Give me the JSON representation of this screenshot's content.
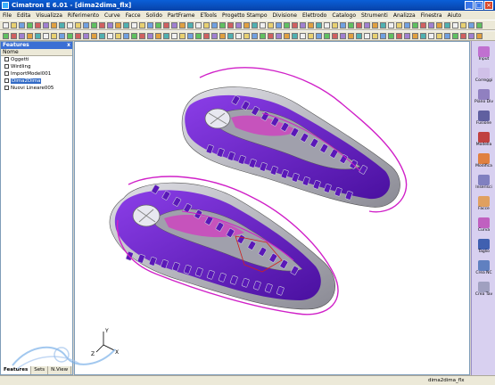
{
  "window": {
    "title": "Cimatron E 6.01 - [dima2dima_flx]",
    "minimize": "_",
    "maximize": "□",
    "close": "×"
  },
  "menu": [
    "File",
    "Edita",
    "Visualizza",
    "Riferimento",
    "Curve",
    "Facce",
    "Solido",
    "PartFrame",
    "ETools",
    "Progetto Stampo",
    "Divisione",
    "Elettrodo",
    "Catalogo",
    "Strumenti",
    "Analizza",
    "Finestra",
    "Aiuto"
  ],
  "features_panel": {
    "title": "Features",
    "close_label": "x",
    "column_header": "Nome",
    "items": [
      {
        "label": "Oggetti",
        "selected": false
      },
      {
        "label": "Wirdling",
        "selected": false
      },
      {
        "label": "ImportModel001",
        "selected": false
      },
      {
        "label": "Dima2Dima",
        "selected": true
      },
      {
        "label": "Nuovi Lineare005",
        "selected": false
      }
    ],
    "tabs": [
      {
        "label": "Features",
        "active": true
      },
      {
        "label": "Sets",
        "active": false
      },
      {
        "label": "N.View",
        "active": false
      }
    ]
  },
  "right_tools": [
    {
      "label": "Input",
      "icon": "input-icon",
      "color": "#c070d0"
    },
    {
      "label": "Correggi",
      "icon": "correggi-icon",
      "color": "#d0c0e8"
    },
    {
      "label": "Piano Div",
      "icon": "piano-div-icon",
      "color": "#9080c0"
    },
    {
      "label": "Fusione",
      "icon": "fusione-icon",
      "color": "#6060a0"
    },
    {
      "label": "Modella",
      "icon": "modella-icon",
      "color": "#c04040"
    },
    {
      "label": "Modifica",
      "icon": "modifica-icon",
      "color": "#e08040"
    },
    {
      "label": "Inserisci",
      "icon": "inserisci-icon",
      "color": "#8080c0"
    },
    {
      "label": "Facce",
      "icon": "facce-icon",
      "color": "#e0a060"
    },
    {
      "label": "Curva",
      "icon": "curva-icon",
      "color": "#c060c0"
    },
    {
      "label": "Taglio",
      "icon": "taglio-icon",
      "color": "#4060b0"
    },
    {
      "label": "Crea NC",
      "icon": "crea-nc-icon",
      "color": "#6080c0"
    },
    {
      "label": "Crea Tav",
      "icon": "crea-tav-icon",
      "color": "#a0a0c0"
    }
  ],
  "axis": {
    "x": "X",
    "y": "Y",
    "z": "Z"
  },
  "status": {
    "file": "dima2dima_flx"
  },
  "colors": {
    "sole_purple": "#6a20c8",
    "outline_magenta": "#d020c8",
    "gray_insole": "#b8b8c0"
  }
}
